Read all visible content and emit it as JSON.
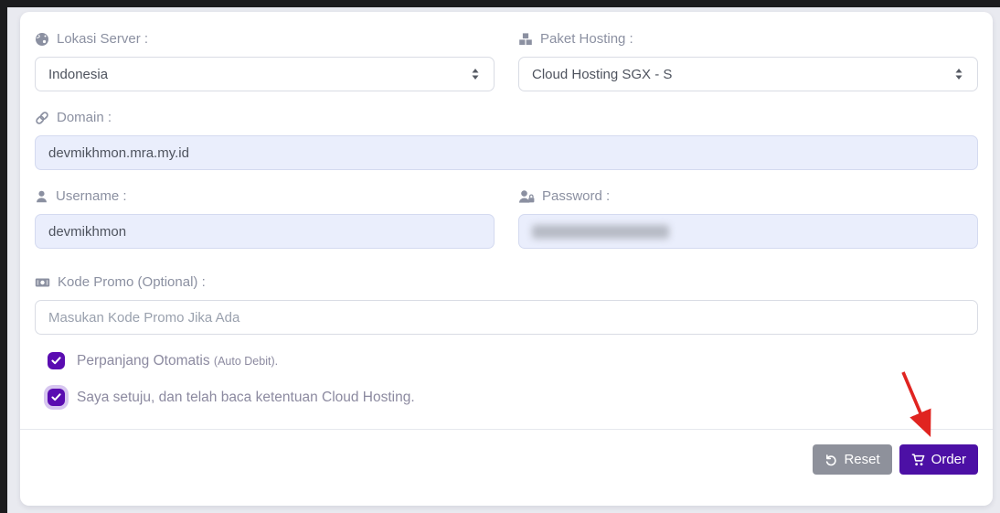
{
  "form": {
    "lokasi_server": {
      "label": "Lokasi Server :",
      "value": "Indonesia"
    },
    "paket_hosting": {
      "label": "Paket Hosting :",
      "value": "Cloud Hosting SGX - S"
    },
    "domain": {
      "label": "Domain :",
      "value": "devmikhmon.mra.my.id"
    },
    "username": {
      "label": "Username :",
      "value": "devmikhmon"
    },
    "password": {
      "label": "Password :",
      "value_display": "blurred-out"
    },
    "kode_promo": {
      "label": "Kode Promo (Optional) :",
      "value": "",
      "placeholder": "Masukan Kode Promo Jika Ada"
    },
    "checkboxes": [
      {
        "label": "Perpanjang Otomatis",
        "suffix": "(Auto Debit).",
        "checked": true
      },
      {
        "label": "Saya setuju, dan telah baca ketentuan Cloud Hosting.",
        "suffix": "",
        "checked": true
      }
    ],
    "actions": {
      "reset": "Reset",
      "order": "Order"
    }
  },
  "icons": {
    "lokasi_server": "globe-asia-icon",
    "paket_hosting": "cubes-icon",
    "domain": "link-icon",
    "username": "user-icon",
    "password": "user-lock-icon",
    "kode_promo": "money-bill-icon",
    "reset": "undo-icon",
    "order": "shopping-cart-icon",
    "annotation": "red-arrow"
  },
  "colors": {
    "checkbox_purple": "#5a0cb1",
    "order_purple": "#4c10a5",
    "reset_gray": "#8e919b",
    "arrow_red": "#e02420",
    "filled_input_bg": "#eaeefc",
    "label_gray": "#8b90a1",
    "frame_dark": "#1c1c1e",
    "page_bg": "#e9eaf0"
  }
}
